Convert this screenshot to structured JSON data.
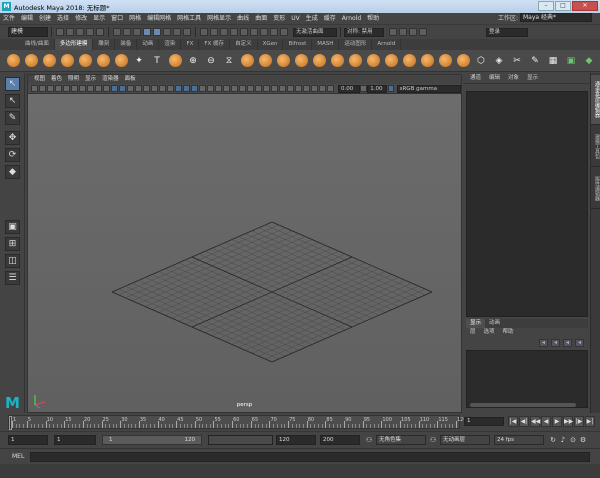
{
  "titlebar": {
    "logo": "M",
    "title": "Autodesk Maya 2018: 无标题*",
    "minimize": "–",
    "maximize": "□",
    "close": "✕"
  },
  "menu": [
    "文件",
    "编辑",
    "创建",
    "选择",
    "修改",
    "显示",
    "窗口",
    "网格",
    "编辑网格",
    "网格工具",
    "网格显示",
    "曲线",
    "曲面",
    "变形",
    "UV",
    "生成",
    "缓存",
    "Arnold",
    "帮助"
  ],
  "workspace": {
    "label": "工作区:",
    "value": "Maya 经典*"
  },
  "statusline": {
    "mode": "建模",
    "no_live": "无激活曲面",
    "symmetry": "对称: 禁用",
    "login": "登录"
  },
  "shelf_tabs": [
    "曲线/曲面",
    "多边形建模",
    "雕刻",
    "装备",
    "动画",
    "渲染",
    "FX",
    "FX 缓存",
    "自定义",
    "XGen",
    "Bifrost",
    "MASH",
    "运动图形",
    "Arnold"
  ],
  "shelf_active": 1,
  "viewport": {
    "menu": [
      "视图",
      "着色",
      "照明",
      "显示",
      "渲染器",
      "面板"
    ],
    "exposure": "0.00",
    "gamma": "1.00",
    "colorspace": "sRGB gamma",
    "camera": "persp"
  },
  "right_panel": {
    "tabs": [
      "通道",
      "编辑",
      "对象",
      "显示"
    ],
    "layer_tabs": [
      "显示",
      "动画"
    ],
    "layer_menu": [
      "层",
      "选项",
      "帮助"
    ],
    "side_tabs": [
      "通道盒/层编辑器",
      "建模工具包",
      "属性编辑器"
    ]
  },
  "timeline": {
    "labels": [
      "1",
      "5",
      "10",
      "15",
      "20",
      "25",
      "30",
      "35",
      "40",
      "45",
      "50",
      "55",
      "60",
      "65",
      "70",
      "75",
      "80",
      "85",
      "90",
      "95",
      "100",
      "105",
      "110",
      "115",
      "120"
    ],
    "current_frame": "1",
    "playback_buttons": [
      "|◀",
      "◀|",
      "◀◀",
      "◀",
      "▶",
      "▶▶",
      "|▶",
      "▶|"
    ]
  },
  "range": {
    "start": "1",
    "anim_start": "1",
    "bar_start": "1",
    "bar_end": "120",
    "anim_end": "120",
    "end": "200",
    "character_set": "无角色集",
    "anim_layer": "无动画层",
    "fps": "24 fps"
  },
  "cmdline": {
    "label": "MEL"
  },
  "colors": {
    "accent": "#5a7fa8",
    "maya_logo": "#19b4c9",
    "shelf_orange": "#f0a040"
  }
}
